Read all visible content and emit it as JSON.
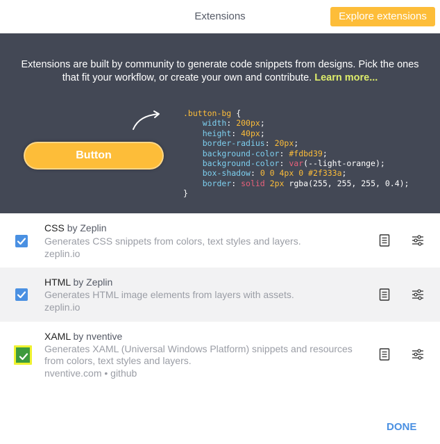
{
  "header": {
    "title": "Extensions",
    "explore_label": "Explore extensions"
  },
  "banner": {
    "intro_text": "Extensions are built by community to generate code snippets from designs. Pick the ones that fit your workflow, or create your own and contribute.",
    "learn_more": "Learn more...",
    "demo_button_label": "Button",
    "code": {
      "selector": ".button-bg",
      "open_brace": "{",
      "close_brace": "}",
      "lines": [
        {
          "prop": "width",
          "num": "200px",
          "val": "",
          "rest": ";"
        },
        {
          "prop": "height",
          "num": "40px",
          "val": "",
          "rest": ";"
        },
        {
          "prop": "border-radius",
          "num": "20px",
          "val": "",
          "rest": ";"
        },
        {
          "prop": "background-color",
          "num": "#fdbd39",
          "val": "",
          "rest": ";"
        },
        {
          "prop": "background-color",
          "num": "",
          "val": "var",
          "rest": "(--light-orange);"
        },
        {
          "prop": "box-shadow",
          "num": "0 0 4px 0 #2f333a",
          "val": "",
          "rest": ";"
        },
        {
          "prop": "border",
          "num": "2px",
          "val": "solid",
          "rest": "rgba(255, 255, 255, 0.4);"
        }
      ]
    }
  },
  "extensions": [
    {
      "name": "CSS",
      "by": "by Zeplin",
      "description": "Generates CSS snippets from colors, text styles and layers.",
      "meta": "zeplin.io",
      "checked": true
    },
    {
      "name": "HTML",
      "by": "by Zeplin",
      "description": "Generates HTML image elements from layers with assets.",
      "meta": "zeplin.io",
      "checked": true
    },
    {
      "name": "XAML",
      "by": "by nventive",
      "description": "Generates XAML (Universal Windows Platform) snippets and resources from colors, text styles and layers.",
      "meta": "nventive.com • github",
      "checked": true
    }
  ],
  "footer": {
    "done_label": "DONE"
  },
  "colors": {
    "accent_orange": "#fdbd39",
    "banner_bg": "#434855",
    "checkbox_blue": "#4a90e2",
    "highlight": "#eff230",
    "link_green": "#ddec6b"
  }
}
